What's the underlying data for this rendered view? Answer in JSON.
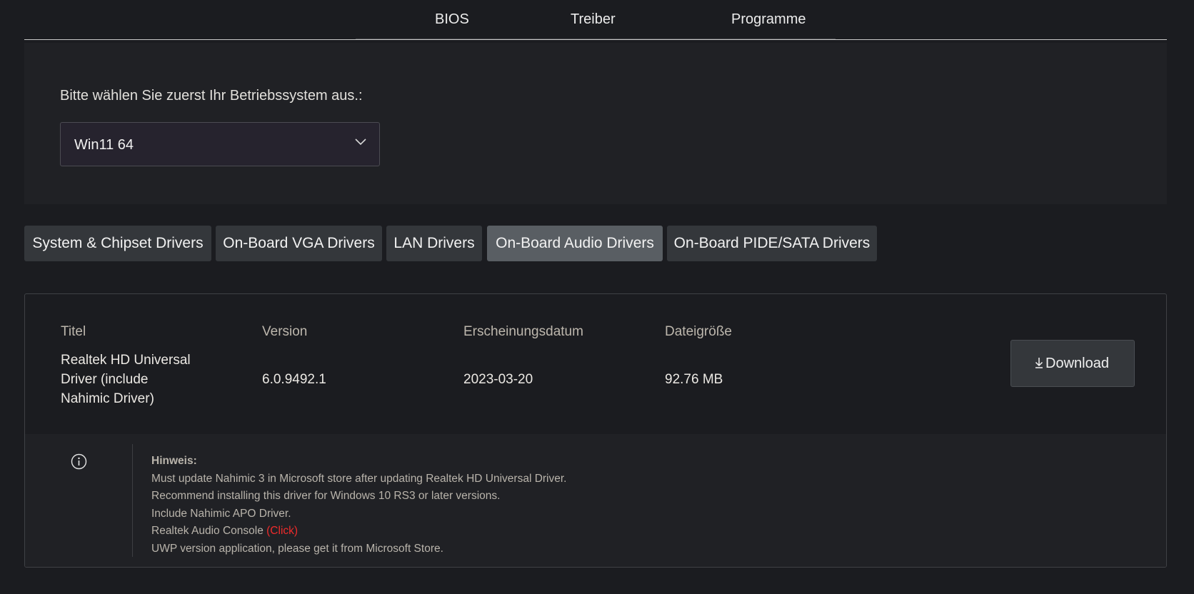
{
  "top_tabs": [
    {
      "label": "BIOS"
    },
    {
      "label": "Treiber"
    },
    {
      "label": "Programme"
    }
  ],
  "os_selector": {
    "prompt": "Bitte wählen Sie zuerst Ihr Betriebssystem aus.:",
    "selected": "Win11 64"
  },
  "categories": [
    {
      "label": "System & Chipset Drivers",
      "active": false
    },
    {
      "label": "On-Board VGA Drivers",
      "active": false
    },
    {
      "label": "LAN Drivers",
      "active": false
    },
    {
      "label": "On-Board Audio Drivers",
      "active": true
    },
    {
      "label": "On-Board PIDE/SATA Drivers",
      "active": false
    }
  ],
  "driver": {
    "headers": {
      "title": "Titel",
      "version": "Version",
      "date": "Erscheinungsdatum",
      "size": "Dateigröße"
    },
    "title_lines": [
      "Realtek HD Universal",
      "Driver (include",
      "Nahimic Driver)"
    ],
    "version": "6.0.9492.1",
    "date": "2023-03-20",
    "size": "92.76 MB",
    "download_label": "Download"
  },
  "note": {
    "title": "Hinweis:",
    "lines": [
      "Must update Nahimic 3 in Microsoft store after updating Realtek HD Universal Driver.",
      "Recommend installing this driver for Windows 10 RS3 or later versions.",
      "Include Nahimic APO Driver."
    ],
    "console_text": "Realtek Audio Console ",
    "console_link": "(Click)",
    "last_line": "UWP version application, please get it from Microsoft Store."
  },
  "colors": {
    "background": "#1b1c20",
    "panel": "#202125",
    "tab": "#34373b",
    "tab_active": "#595e63",
    "link": "#ef2b2b"
  },
  "icons": {
    "select": "chevron-down-icon",
    "download": "download-arrow-icon",
    "info": "info-circle-icon"
  }
}
